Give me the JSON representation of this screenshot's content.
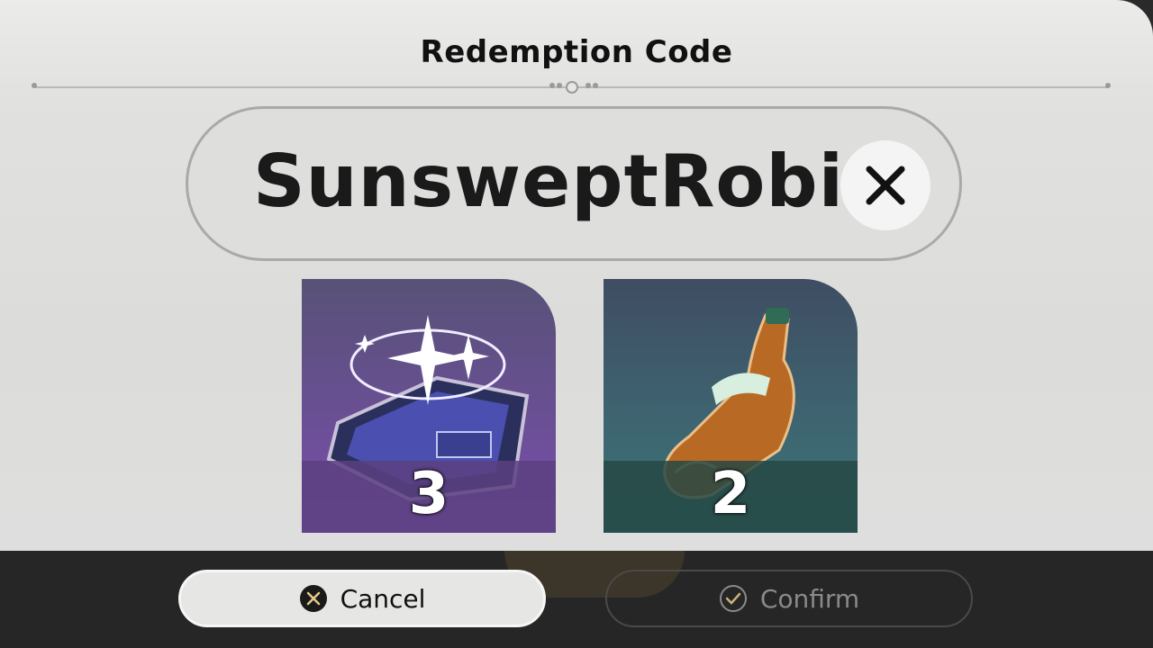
{
  "dialog": {
    "title": "Redemption Code",
    "code_value": "SunsweptRobin"
  },
  "rewards": [
    {
      "name": "book-item-icon",
      "count": "3"
    },
    {
      "name": "bottle-item-icon",
      "count": "2"
    }
  ],
  "buttons": {
    "cancel_label": "Cancel",
    "confirm_label": "Confirm"
  },
  "colors": {
    "dialog_bg": "#e1e1df",
    "bar_bg": "#262626",
    "reward1_bg": "#6a4f94",
    "reward2_bg": "#3e6470"
  }
}
